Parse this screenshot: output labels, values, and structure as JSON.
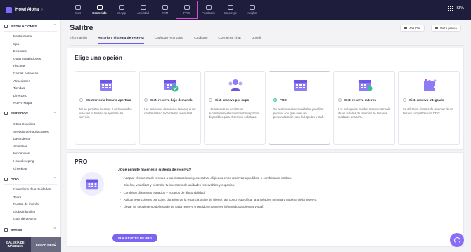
{
  "app": {
    "hotel_name": "Hotel Aloha",
    "language": "SPA"
  },
  "topnav": [
    {
      "label": "Inicio",
      "icon": "home-icon"
    },
    {
      "label": "Contenido",
      "icon": "content-icon"
    },
    {
      "label": "Mi App",
      "icon": "phone-icon"
    },
    {
      "label": "Actividad",
      "icon": "activity-icon"
    },
    {
      "label": "CRM",
      "icon": "crm-icon"
    },
    {
      "label": "PRO",
      "icon": "pro-icon"
    },
    {
      "label": "Feedback",
      "icon": "feedback-icon"
    },
    {
      "label": "Concierge",
      "icon": "concierge-icon"
    },
    {
      "label": "Insights",
      "icon": "insights-icon"
    }
  ],
  "sidebar": {
    "sections": [
      {
        "title": "INSTALACIONES",
        "items": [
          "Restaurantes",
          "Spa",
          "Deportes",
          "Otras instalaciones",
          "Piscinas",
          "Camas balinesas",
          "Atracciones",
          "Tiendas",
          "Directorio",
          "Nuevo Mapa"
        ]
      },
      {
        "title": "SERVICIOS",
        "items": [
          "Otros Servicios",
          "Servicio de habitaciones",
          "Lavandería",
          "Amenities",
          "Incidencias",
          "Housekeeping",
          "Checkout"
        ]
      },
      {
        "title": "OCIO",
        "items": [
          "Calendario de Actividades",
          "Tours",
          "Puntos de interés",
          "Clubs infantiles",
          "Guía de destino"
        ]
      },
      {
        "title": "OTROS",
        "items": []
      }
    ],
    "footer": {
      "gallery": "GALERÍA DE IMÁGENES",
      "edit_menu": "EDITAR MENÚ"
    }
  },
  "page": {
    "title": "Salitre",
    "help_button": "AYUDA",
    "preview_button": "Vista previa",
    "tabs": [
      "Información",
      "Horario y sistema de reserva",
      "Catálogo Avanzado",
      "Catálogo",
      "Concierge chat",
      "Upsell"
    ],
    "active_tab": "Horario y sistema de reserva"
  },
  "options_panel": {
    "heading": "Elige una opción",
    "selected": "PRO",
    "options": [
      {
        "title": "Mostrar solo horario apertura",
        "desc": "No se permiten reservas. Los huéspedes solo ven el horario de apertura del servicio."
      },
      {
        "title": "Sist. reserva bajo demanda",
        "desc": "Las peticiones de reserva tienen que ser confirmadas o rechazadas por el staff."
      },
      {
        "title": "Sist. reserva por cupo",
        "desc": "Las reservas se confirman automáticamente mientras haya plazas disponibles para el servicio solicitado."
      },
      {
        "title": "PRO",
        "desc": "Se permite reservar unidades y realizar pedidos con gran nivel de personalización para huéspedes y staff."
      },
      {
        "title": "Sist. reserva externo",
        "desc": "Los huéspedes pueden reservar a través de un sistema de reservas de terceros mediante una URL."
      },
      {
        "title": "Sist. reserva integrado",
        "desc": "Se utiliza un sistema de reservas de un tercero compatible con STAY."
      }
    ]
  },
  "pro_panel": {
    "title": "PRO",
    "question": "¿Qué permite hacer este sistema de reserva?",
    "bullets": [
      "Adaptar el sistema de reserva a tus instalaciones y operativa, eligiendo entre reservas o pedidos, o combinando ambos.",
      "Diseñar, visualizar y controlar tu inventario de unidades reservables y espacios.",
      "Combinar diferentes espacios y horarios de disponibilidad.",
      "Aplicar restricciones por cupo, duración de la estancia o tipo de cliente, así como especificar la antelación mínima y máxima de la reserva.",
      "Llevar un seguimiento del estado de cada reserva o pedido y mantener informados a clientes y staff."
    ],
    "cta": "IR A AJUSTES DE PRO"
  },
  "colors": {
    "topbar": "#1e1e3c",
    "accent": "#7a64f2",
    "selected_radio": "#35c08c",
    "pro_outline": "#d94bd3"
  }
}
